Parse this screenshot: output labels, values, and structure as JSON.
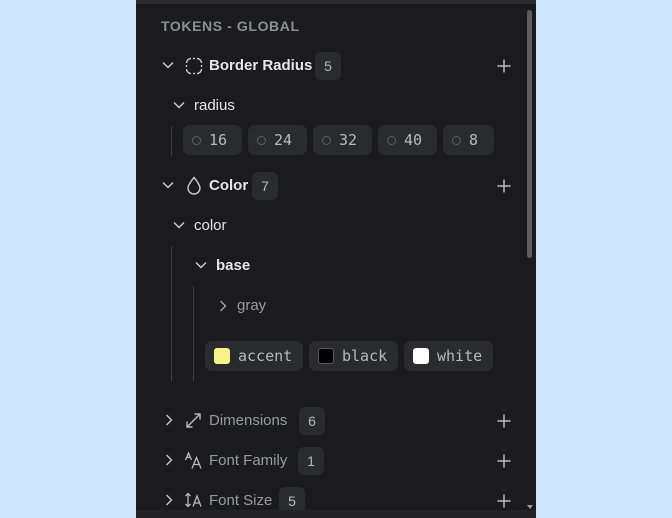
{
  "header": {
    "title": "TOKENS - GLOBAL"
  },
  "border_radius": {
    "label": "Border Radius",
    "count": "5",
    "group": {
      "label": "radius"
    },
    "tokens": [
      "16",
      "24",
      "32",
      "40",
      "8"
    ]
  },
  "color": {
    "label": "Color",
    "count": "7",
    "group": {
      "label": "color"
    },
    "subgroup": {
      "label": "base"
    },
    "nested": {
      "label": "gray"
    },
    "tokens": [
      {
        "label": "accent",
        "swatch": "#f7f48a"
      },
      {
        "label": "black",
        "swatch": "#000000"
      },
      {
        "label": "white",
        "swatch": "#ffffff"
      }
    ]
  },
  "dimensions": {
    "label": "Dimensions",
    "count": "6"
  },
  "font_family": {
    "label": "Font Family",
    "count": "1"
  },
  "font_size": {
    "label": "Font Size",
    "count": "5"
  }
}
